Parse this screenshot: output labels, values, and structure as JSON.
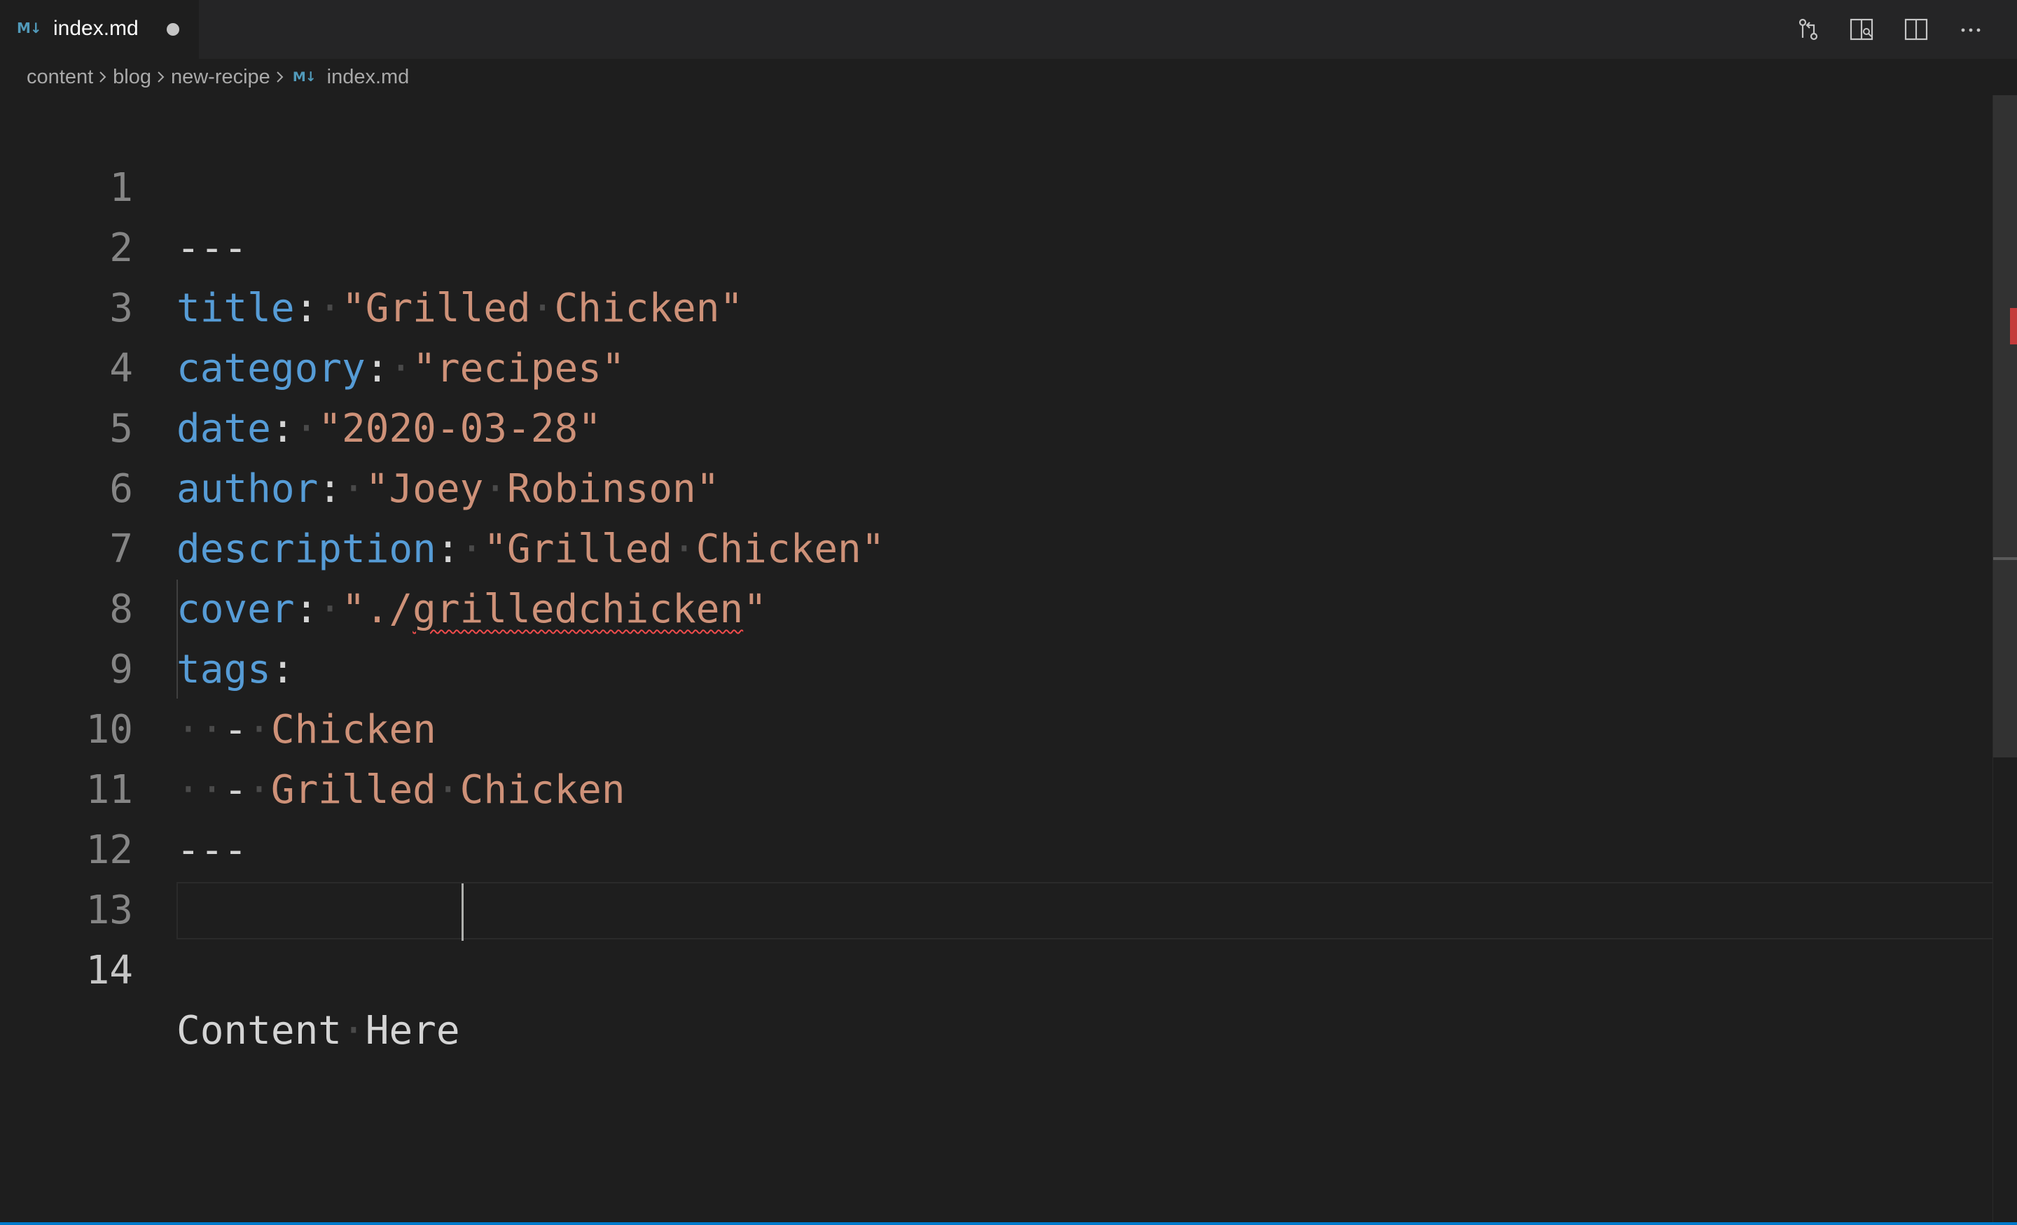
{
  "tab": {
    "icon": "markdown-icon",
    "icon_text": "M↓",
    "title": "index.md",
    "dirty": true
  },
  "actions": [
    {
      "name": "open-changes-icon"
    },
    {
      "name": "open-preview-to-side-icon"
    },
    {
      "name": "split-editor-icon"
    },
    {
      "name": "more-actions-icon"
    }
  ],
  "breadcrumb": {
    "items": [
      "content",
      "blog",
      "new-recipe",
      "index.md"
    ],
    "file_icon_text": "M↓"
  },
  "editor": {
    "line_numbers": [
      "1",
      "2",
      "3",
      "4",
      "5",
      "6",
      "7",
      "8",
      "9",
      "10",
      "11",
      "12",
      "13",
      "14"
    ],
    "lines": {
      "l1": "---",
      "l2_key": "title",
      "l2_val": "\"Grilled·Chicken\"",
      "l3_key": "category",
      "l3_val": "\"recipes\"",
      "l4_key": "date",
      "l4_val": "\"2020-03-28\"",
      "l5_key": "author",
      "l5_val": "\"Joey·Robinson\"",
      "l6_key": "description",
      "l6_val": "\"Grilled·Chicken\"",
      "l7_key": "cover",
      "l7_q1": "\"./",
      "l7_val": "grilledchicken",
      "l7_q2": "\"",
      "l8_key": "tags",
      "l9_val": "Chicken",
      "l10_val": "Grilled·Chicken",
      "l11": "---",
      "l14": "Content·Here"
    },
    "current_line": 14
  },
  "colors": {
    "background": "#1e1e1e",
    "key": "#569cd6",
    "string": "#ce9178",
    "text": "#d4d4d4",
    "accent": "#007acc"
  }
}
